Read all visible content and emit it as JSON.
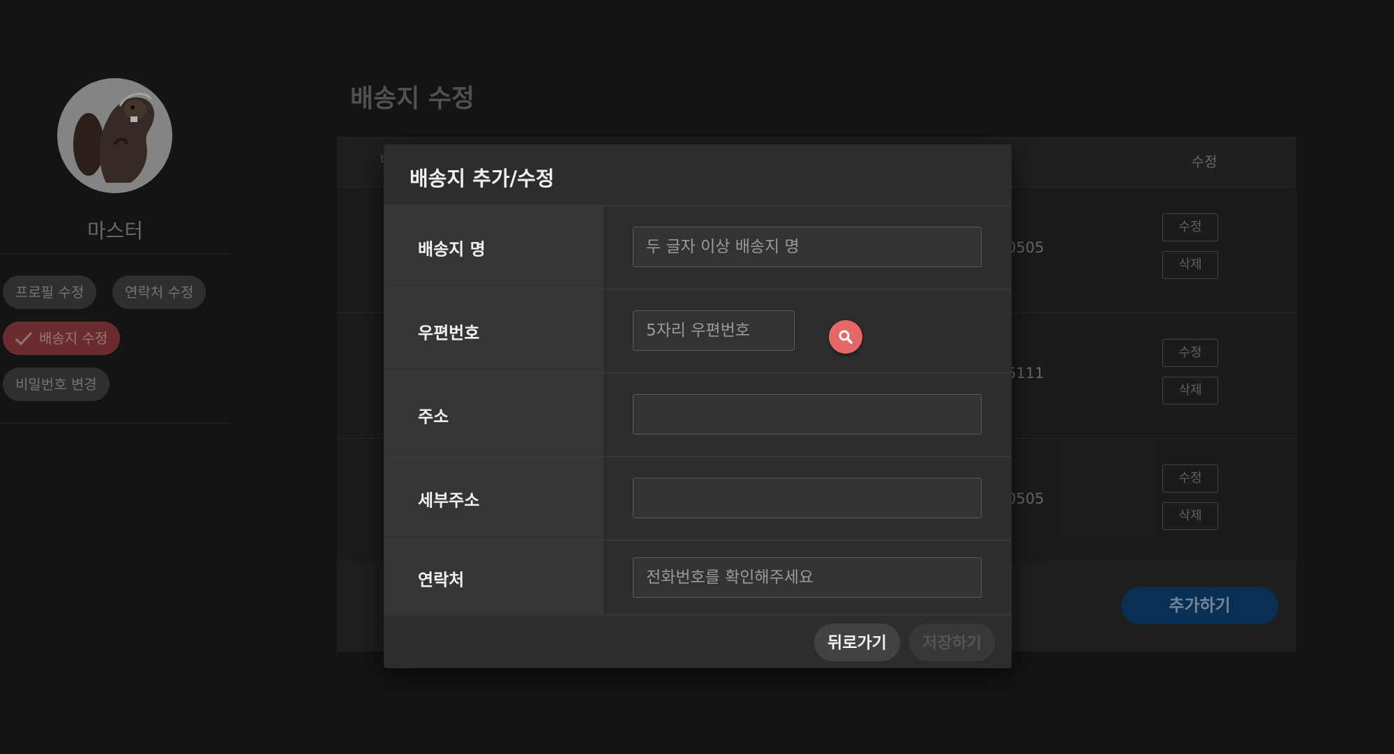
{
  "sidebar": {
    "username": "마스터",
    "menu": {
      "profile_edit": "프로필 수정",
      "contact_edit": "연락처 수정",
      "address_edit": "배송지 수정",
      "password_change": "비밀번호 변경"
    },
    "active_item": "배송지 수정"
  },
  "page": {
    "title": "배송지 수정",
    "table_header_partial": "b",
    "edit_column_label": "수정",
    "rows": [
      {
        "phone_partial": "0505",
        "edit_label": "수정",
        "delete_label": "삭제"
      },
      {
        "phone_partial": "5111",
        "edit_label": "수정",
        "delete_label": "삭제"
      },
      {
        "phone_partial": "0505",
        "edit_label": "수정",
        "delete_label": "삭제"
      }
    ],
    "add_button": "추가하기"
  },
  "modal": {
    "title": "배송지 추가/수정",
    "fields": {
      "name": {
        "label": "배송지 명",
        "placeholder": "두 글자 이상 배송지 명",
        "value": ""
      },
      "zipcode": {
        "label": "우편번호",
        "placeholder": "5자리 우편번호",
        "value": ""
      },
      "address": {
        "label": "주소",
        "placeholder": "",
        "value": ""
      },
      "detail_address": {
        "label": "세부주소",
        "placeholder": "",
        "value": ""
      },
      "phone": {
        "label": "연락처",
        "placeholder": "전화번호를 확인해주세요",
        "value": ""
      }
    },
    "search_icon": "search-icon",
    "back_button": "뒤로가기",
    "save_button": "저장하기"
  },
  "colors": {
    "background": "#1b1b1b",
    "modal_bg": "#2d2d2d",
    "active_chip": "#8e3b3f",
    "search_button": "#e46868",
    "add_button": "#0c3f72"
  }
}
